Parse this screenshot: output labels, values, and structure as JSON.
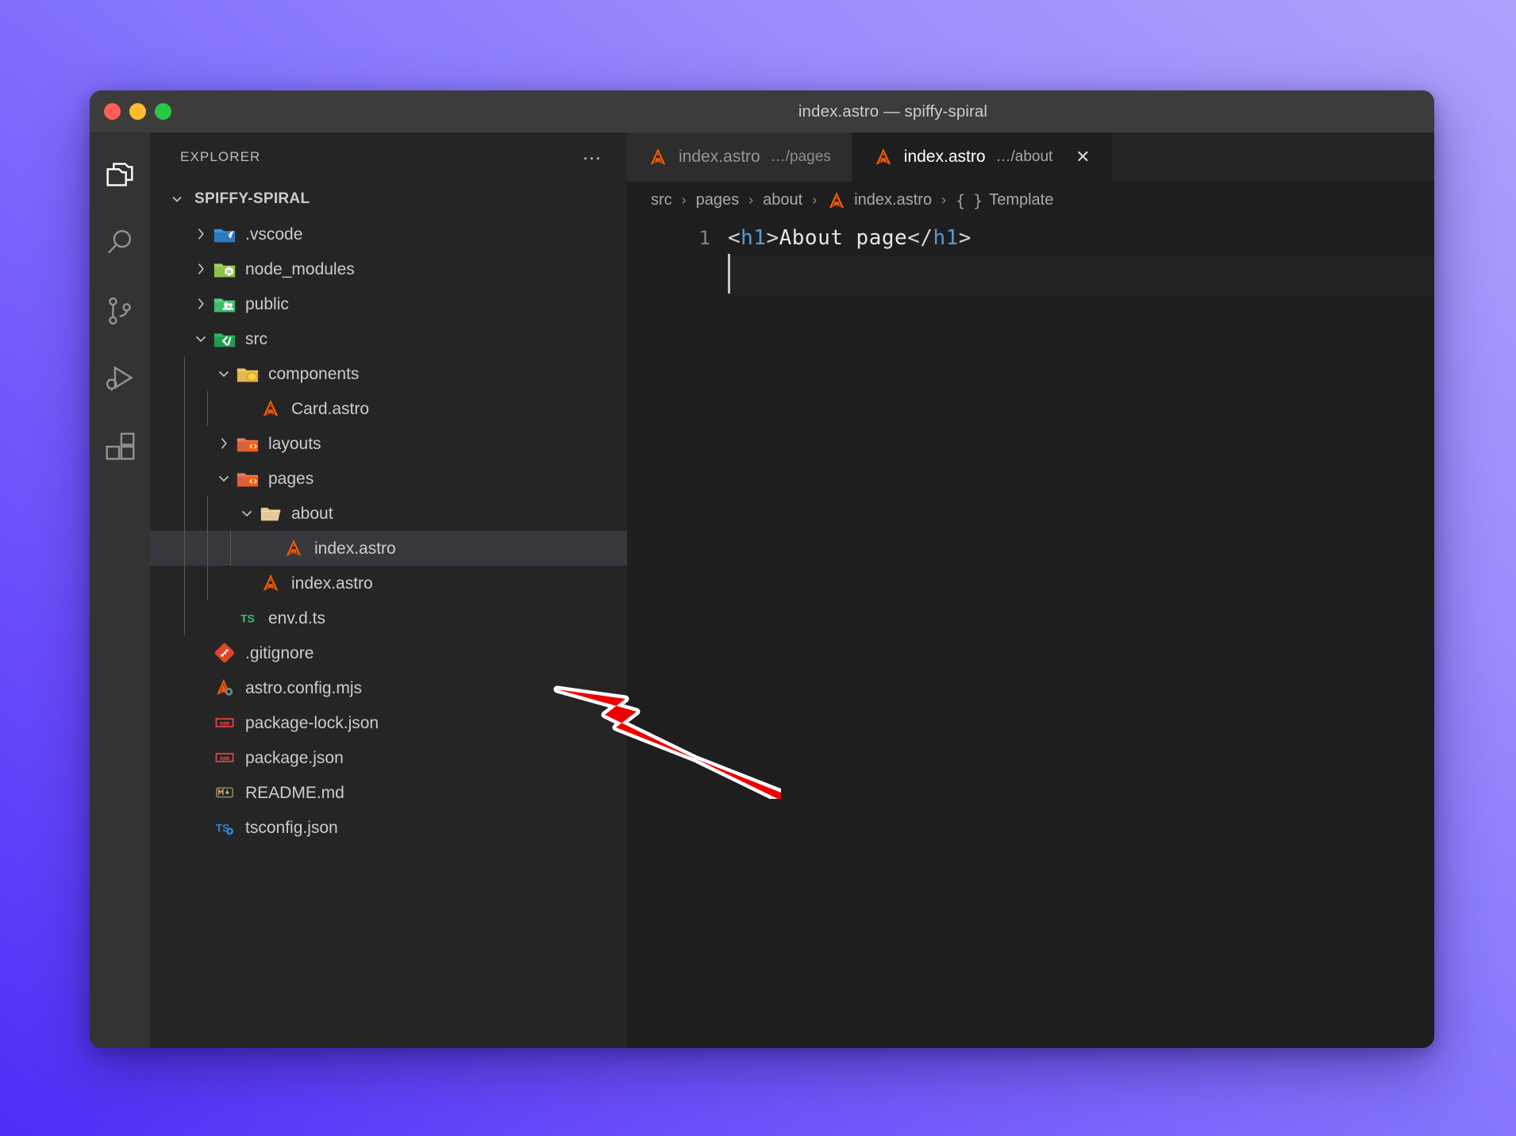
{
  "window": {
    "title": "index.astro — spiffy-spiral",
    "traffic_lights": [
      {
        "name": "close-button",
        "color": "#ff5f57"
      },
      {
        "name": "minimize-button",
        "color": "#febc2e"
      },
      {
        "name": "maximize-button",
        "color": "#28c840"
      }
    ]
  },
  "activity_bar": {
    "items": [
      {
        "icon": "files-explorer-icon",
        "label": "Explorer",
        "active": true
      },
      {
        "icon": "search-icon",
        "label": "Search",
        "active": false
      },
      {
        "icon": "source-control-icon",
        "label": "Source Control",
        "active": false
      },
      {
        "icon": "run-debug-icon",
        "label": "Run and Debug",
        "active": false
      },
      {
        "icon": "extensions-icon",
        "label": "Extensions",
        "active": false
      }
    ]
  },
  "sidebar": {
    "header_title": "EXPLORER",
    "more_actions": "…",
    "root": {
      "label": "SPIFFY-SPIRAL",
      "expanded": true,
      "chevron": "chevron-down-icon"
    },
    "tree": [
      {
        "label": ".vscode",
        "type": "folder",
        "icon": "vscode-folder-icon",
        "depth": 1,
        "expanded": false,
        "chevron": "chevron-right-icon",
        "selected": false
      },
      {
        "label": "node_modules",
        "type": "folder",
        "icon": "node-folder-icon",
        "depth": 1,
        "expanded": false,
        "chevron": "chevron-right-icon",
        "selected": false
      },
      {
        "label": "public",
        "type": "folder",
        "icon": "public-folder-icon",
        "depth": 1,
        "expanded": false,
        "chevron": "chevron-right-icon",
        "selected": false
      },
      {
        "label": "src",
        "type": "folder",
        "icon": "src-folder-icon",
        "depth": 1,
        "expanded": true,
        "chevron": "chevron-down-icon",
        "selected": false
      },
      {
        "label": "components",
        "type": "folder",
        "icon": "components-folder-icon",
        "depth": 2,
        "expanded": true,
        "chevron": "chevron-down-icon",
        "selected": false
      },
      {
        "label": "Card.astro",
        "type": "file",
        "icon": "astro-file-icon",
        "depth": 3,
        "expanded": null,
        "chevron": "",
        "selected": false
      },
      {
        "label": "layouts",
        "type": "folder",
        "icon": "layouts-folder-icon",
        "depth": 2,
        "expanded": false,
        "chevron": "chevron-right-icon",
        "selected": false
      },
      {
        "label": "pages",
        "type": "folder",
        "icon": "pages-folder-icon",
        "depth": 2,
        "expanded": true,
        "chevron": "chevron-down-icon",
        "selected": false
      },
      {
        "label": "about",
        "type": "folder",
        "icon": "open-folder-icon",
        "depth": 3,
        "expanded": true,
        "chevron": "chevron-down-icon",
        "selected": false
      },
      {
        "label": "index.astro",
        "type": "file",
        "icon": "astro-file-icon",
        "depth": 4,
        "expanded": null,
        "chevron": "",
        "selected": true
      },
      {
        "label": "index.astro",
        "type": "file",
        "icon": "astro-file-icon",
        "depth": 3,
        "expanded": null,
        "chevron": "",
        "selected": false
      },
      {
        "label": "env.d.ts",
        "type": "file",
        "icon": "typescript-def-icon",
        "depth": 2,
        "expanded": null,
        "chevron": "",
        "selected": false
      },
      {
        "label": ".gitignore",
        "type": "file",
        "icon": "git-icon",
        "depth": 1,
        "expanded": null,
        "chevron": "",
        "selected": false
      },
      {
        "label": "astro.config.mjs",
        "type": "file",
        "icon": "astro-config-icon",
        "depth": 1,
        "expanded": null,
        "chevron": "",
        "selected": false
      },
      {
        "label": "package-lock.json",
        "type": "file",
        "icon": "npm-icon",
        "depth": 1,
        "expanded": null,
        "chevron": "",
        "selected": false
      },
      {
        "label": "package.json",
        "type": "file",
        "icon": "npm-icon",
        "depth": 1,
        "expanded": null,
        "chevron": "",
        "selected": false
      },
      {
        "label": "README.md",
        "type": "file",
        "icon": "markdown-icon",
        "depth": 1,
        "expanded": null,
        "chevron": "",
        "selected": false
      },
      {
        "label": "tsconfig.json",
        "type": "file",
        "icon": "tsconfig-icon",
        "depth": 1,
        "expanded": null,
        "chevron": "",
        "selected": false
      }
    ]
  },
  "editor": {
    "tabs": [
      {
        "label": "index.astro",
        "description": "…/pages",
        "icon": "astro-file-icon",
        "active": false,
        "closable": false
      },
      {
        "label": "index.astro",
        "description": "…/about",
        "icon": "astro-file-icon",
        "active": true,
        "closable": true,
        "close_glyph": "✕"
      }
    ],
    "breadcrumb": [
      {
        "label": "src",
        "icon": ""
      },
      {
        "label": "pages",
        "icon": ""
      },
      {
        "label": "about",
        "icon": ""
      },
      {
        "label": "index.astro",
        "icon": "astro-file-icon"
      },
      {
        "label": "Template",
        "icon": "braces-symbol"
      }
    ],
    "breadcrumb_separator": "›",
    "code": {
      "lines": [
        {
          "number": "1",
          "tokens": [
            {
              "text": "<",
              "kind": "punct"
            },
            {
              "text": "h1",
              "kind": "tag"
            },
            {
              "text": ">",
              "kind": "punct"
            },
            {
              "text": "About page",
              "kind": "text"
            },
            {
              "text": "</",
              "kind": "punct"
            },
            {
              "text": "h1",
              "kind": "tag"
            },
            {
              "text": ">",
              "kind": "punct"
            }
          ]
        }
      ],
      "cursor_line": 2,
      "cursor_column": 1
    }
  },
  "annotation": {
    "arrow": {
      "name": "red-pointer-arrow",
      "color": "#ee0000",
      "outline": "#ffffff",
      "points_to": "index.astro (src/pages/about)"
    }
  },
  "colors": {
    "desktop_gradient_start": "#4f2ef8",
    "desktop_gradient_end": "#aca2fc",
    "titlebar": "#3c3c3c",
    "activity_bar": "#333333",
    "sidebar": "#252526",
    "editor": "#1e1e1e",
    "tab_inactive": "#2d2d2d",
    "row_selected": "#37373d",
    "astro_orange": "#ff5d01",
    "tag_blue": "#569cd6"
  }
}
